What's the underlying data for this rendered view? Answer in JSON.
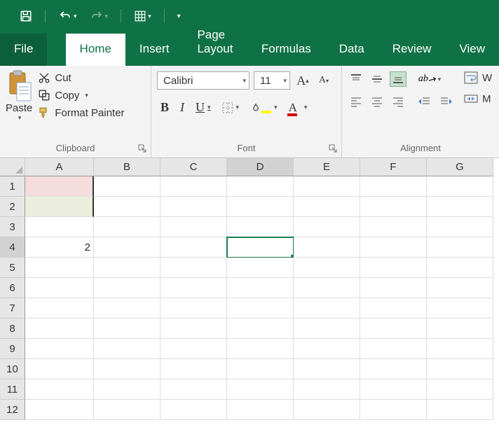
{
  "tabs": {
    "file": "File",
    "home": "Home",
    "insert": "Insert",
    "pageLayout": "Page Layout",
    "formulas": "Formulas",
    "data": "Data",
    "review": "Review",
    "view": "View"
  },
  "clipboard": {
    "paste": "Paste",
    "cut": "Cut",
    "copy": "Copy",
    "formatPainter": "Format Painter",
    "label": "Clipboard"
  },
  "font": {
    "name": "Calibri",
    "size": "11",
    "label": "Font",
    "bold": "B",
    "italic": "I",
    "underline": "U"
  },
  "alignment": {
    "label": "Alignment"
  },
  "partial": {
    "wrap": "W",
    "merge": "M"
  },
  "columns": [
    "A",
    "B",
    "C",
    "D",
    "E",
    "F",
    "G"
  ],
  "rows": [
    "1",
    "2",
    "3",
    "4",
    "5",
    "6",
    "7",
    "8",
    "9",
    "10",
    "11",
    "12"
  ],
  "cells": {
    "A1": {
      "value": "",
      "bg": "#f5dddd"
    },
    "A2": {
      "value": "",
      "bg": "#eceedd"
    },
    "A4": {
      "value": "2"
    }
  },
  "activeCell": "D4",
  "colWidths": {
    "A": 98,
    "B": 95,
    "C": 95,
    "D": 95,
    "E": 95,
    "F": 95,
    "G": 95
  }
}
